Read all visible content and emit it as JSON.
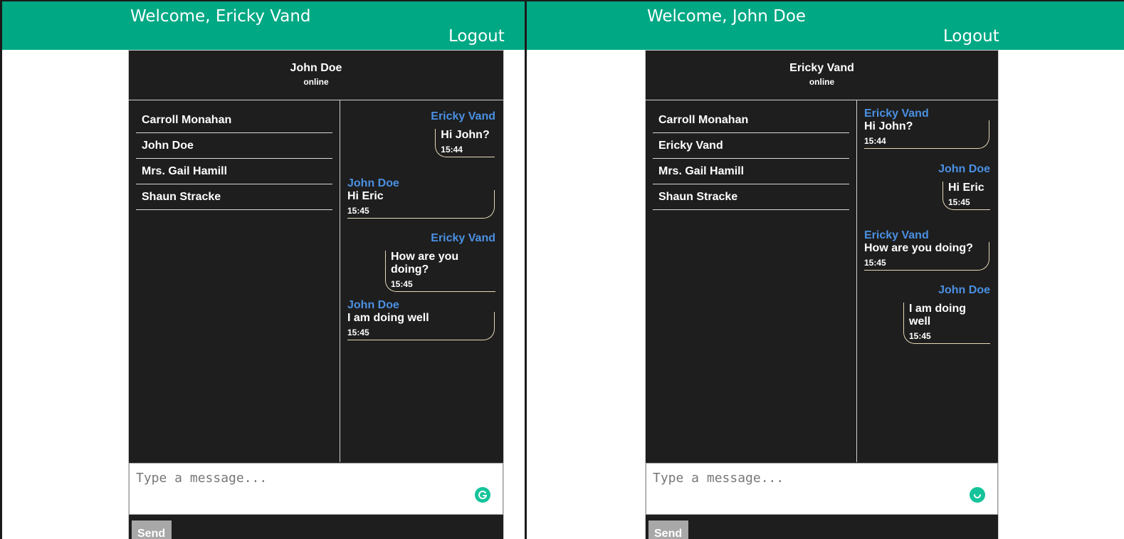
{
  "windows": [
    {
      "welcome": "Welcome, Ericky Vand",
      "logout": "Logout",
      "chat_header": {
        "name": "John Doe",
        "status": "online"
      },
      "contacts": [
        "Carroll Monahan",
        "John Doe",
        "Mrs. Gail Hamill",
        "Shaun Stracke"
      ],
      "messages": [
        {
          "sender": "Ericky Vand",
          "text": "Hi John?",
          "time": "15:44",
          "side": "right"
        },
        {
          "sender": "John Doe",
          "text": "Hi Eric",
          "time": "15:45",
          "side": "left"
        },
        {
          "sender": "Ericky Vand",
          "text": "How are you doing?",
          "time": "15:45",
          "side": "right"
        },
        {
          "sender": "John Doe",
          "text": "I am doing well",
          "time": "15:45",
          "side": "left"
        }
      ],
      "input_placeholder": "Type a message...",
      "send_label": "Send"
    },
    {
      "welcome": "Welcome, John Doe",
      "logout": "Logout",
      "chat_header": {
        "name": "Ericky Vand",
        "status": "online"
      },
      "contacts": [
        "Carroll Monahan",
        "Ericky Vand",
        "Mrs. Gail Hamill",
        "Shaun Stracke"
      ],
      "messages": [
        {
          "sender": "Ericky Vand",
          "text": "Hi John?",
          "time": "15:44",
          "side": "left"
        },
        {
          "sender": "John Doe",
          "text": "Hi Eric",
          "time": "15:45",
          "side": "right"
        },
        {
          "sender": "Ericky Vand",
          "text": "How are you doing?",
          "time": "15:45",
          "side": "left"
        },
        {
          "sender": "John Doe",
          "text": "I am doing well",
          "time": "15:45",
          "side": "right"
        }
      ],
      "input_placeholder": "Type a message...",
      "send_label": "Send"
    }
  ],
  "colors": {
    "topbar": "#00a884",
    "chat_bg": "#1e1e1e",
    "sender_name": "#4a90e2",
    "grammarly": "#15c39a"
  },
  "icons": {
    "grammarly": "grammarly-icon"
  }
}
